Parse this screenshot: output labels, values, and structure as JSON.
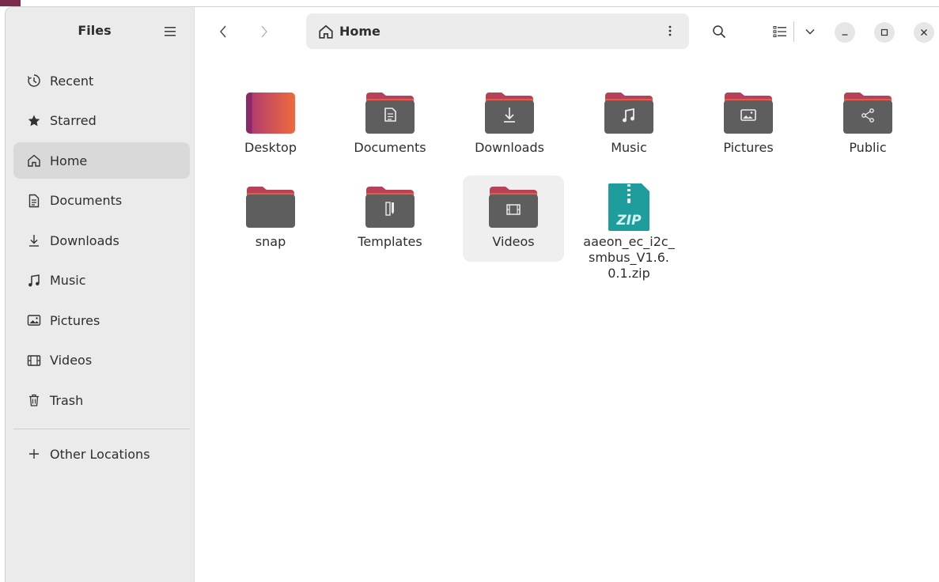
{
  "window": {
    "app_title": "Files"
  },
  "sidebar": {
    "title": "Files",
    "items": [
      {
        "label": "Recent",
        "icon": "clock-icon"
      },
      {
        "label": "Starred",
        "icon": "star-icon"
      },
      {
        "label": "Home",
        "icon": "home-icon",
        "active": true
      },
      {
        "label": "Documents",
        "icon": "document-icon"
      },
      {
        "label": "Downloads",
        "icon": "download-icon"
      },
      {
        "label": "Music",
        "icon": "music-icon"
      },
      {
        "label": "Pictures",
        "icon": "picture-icon"
      },
      {
        "label": "Videos",
        "icon": "film-icon"
      },
      {
        "label": "Trash",
        "icon": "trash-icon"
      }
    ],
    "other": {
      "label": "Other Locations",
      "icon": "plus-icon"
    }
  },
  "header": {
    "path_label": "Home",
    "path_icon": "home-icon"
  },
  "content": {
    "files": [
      {
        "name": "Desktop",
        "icon": "desktop-folder-icon"
      },
      {
        "name": "Documents",
        "icon": "document-icon"
      },
      {
        "name": "Downloads",
        "icon": "download-icon"
      },
      {
        "name": "Music",
        "icon": "music-icon"
      },
      {
        "name": "Pictures",
        "icon": "picture-icon"
      },
      {
        "name": "Public",
        "icon": "share-icon"
      },
      {
        "name": "snap",
        "icon": "folder-icon"
      },
      {
        "name": "Templates",
        "icon": "template-icon"
      },
      {
        "name": "Videos",
        "icon": "film-icon",
        "selected": true
      },
      {
        "name": "aaeon_ec_i2c_smbus_V1.6.0.1.zip",
        "icon": "zip-icon"
      }
    ]
  },
  "colors": {
    "folder_body": "#5e5e5e",
    "folder_tab": "#b8415a",
    "folder_tab_light": "#e95a42",
    "desktop_left": "#8a2a6a",
    "desktop_right": "#ee6b3b",
    "zip": "#1f9c9c",
    "sidebar_bg": "#ebebeb",
    "active_item": "#d9d9d9"
  }
}
